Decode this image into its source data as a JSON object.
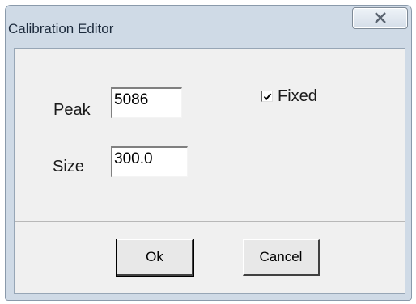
{
  "window": {
    "title": "Calibration Editor"
  },
  "form": {
    "peak_label": "Peak",
    "peak_value": "5086",
    "size_label": "Size",
    "size_value": "300.0",
    "fixed_label": "Fixed",
    "fixed_checked": true
  },
  "buttons": {
    "ok_label": "Ok",
    "cancel_label": "Cancel"
  },
  "icons": {
    "close": "close-icon",
    "check": "checkmark-icon"
  }
}
